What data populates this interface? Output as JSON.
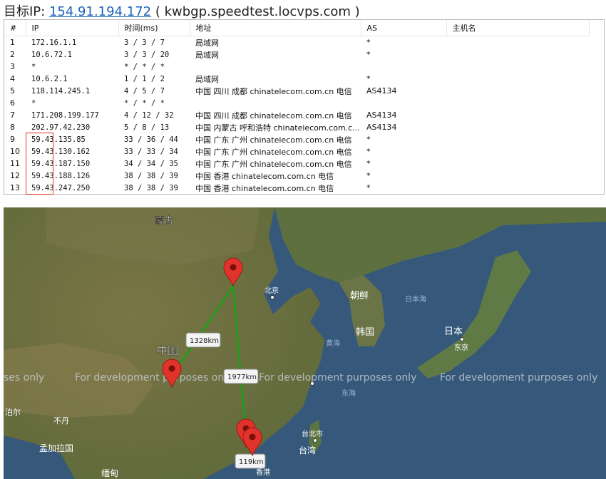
{
  "header": {
    "prefix": "目标IP:",
    "ip": "154.91.194.172",
    "host": "( kwbgp.speedtest.locvps.com )"
  },
  "table": {
    "columns": [
      "#",
      "IP",
      "时间(ms)",
      "地址",
      "AS",
      "主机名"
    ],
    "rows": [
      {
        "n": "1",
        "ip": "172.16.1.1",
        "time": "3 / 3 / 7",
        "addr": "局域网",
        "as": "*",
        "host": ""
      },
      {
        "n": "2",
        "ip": "10.6.72.1",
        "time": "3 / 3 / 20",
        "addr": "局域网",
        "as": "*",
        "host": ""
      },
      {
        "n": "3",
        "ip": "*",
        "time": "* / * / *",
        "addr": "",
        "as": "",
        "host": ""
      },
      {
        "n": "4",
        "ip": "10.6.2.1",
        "time": "1 / 1 / 2",
        "addr": "局域网",
        "as": "*",
        "host": ""
      },
      {
        "n": "5",
        "ip": "118.114.245.1",
        "time": "4 / 5 / 7",
        "addr": "中国 四川 成都 chinatelecom.com.cn 电信",
        "as": "AS4134",
        "host": ""
      },
      {
        "n": "6",
        "ip": "*",
        "time": "* / * / *",
        "addr": "",
        "as": "",
        "host": ""
      },
      {
        "n": "7",
        "ip": "171.208.199.177",
        "time": "4 / 12 / 32",
        "addr": "中国 四川 成都 chinatelecom.com.cn 电信",
        "as": "AS4134",
        "host": ""
      },
      {
        "n": "8",
        "ip": "202.97.42.230",
        "time": "5 / 8 / 13",
        "addr": "中国 内蒙古 呼和浩特 chinatelecom.com.c...",
        "as": "AS4134",
        "host": ""
      },
      {
        "n": "9",
        "ip": "59.43.135.85",
        "time": "33 / 36 / 44",
        "addr": "中国 广东 广州 chinatelecom.com.cn 电信",
        "as": "*",
        "host": ""
      },
      {
        "n": "10",
        "ip": "59.43.130.162",
        "time": "33 / 33 / 34",
        "addr": "中国 广东 广州 chinatelecom.com.cn 电信",
        "as": "*",
        "host": ""
      },
      {
        "n": "11",
        "ip": "59.43.187.150",
        "time": "34 / 34 / 35",
        "addr": "中国 广东 广州 chinatelecom.com.cn 电信",
        "as": "*",
        "host": ""
      },
      {
        "n": "12",
        "ip": "59.43.188.126",
        "time": "38 / 38 / 39",
        "addr": "中国 香港 chinatelecom.com.cn 电信",
        "as": "*",
        "host": ""
      },
      {
        "n": "13",
        "ip": "59.43.247.250",
        "time": "38 / 38 / 39",
        "addr": "中国 香港 chinatelecom.com.cn 电信",
        "as": "*",
        "host": ""
      }
    ]
  },
  "map": {
    "watermark": "For development purposes only",
    "watermark_partial": "ses only",
    "labels": {
      "mongolia": "蒙古",
      "china": "中国",
      "beijing": "北京",
      "korea_n": "朝鲜",
      "korea_s": "韩国",
      "japan": "日本",
      "tokyo": "东京",
      "sea_japan": "日本海",
      "yellow_sea": "黄海",
      "east_sea": "东海",
      "taipei": "台北市",
      "taiwan": "台湾",
      "hongkong": "香港",
      "bangladesh": "孟加拉国",
      "myanmar": "缅甸",
      "nepal": "泊尔",
      "bhutan": "不丹"
    },
    "distances": [
      "1328km",
      "1977km",
      "119km"
    ],
    "colors": {
      "route": "#1aa01a",
      "pin": "#e0332b",
      "water": "#36587a",
      "land": "#6e6a40"
    }
  }
}
